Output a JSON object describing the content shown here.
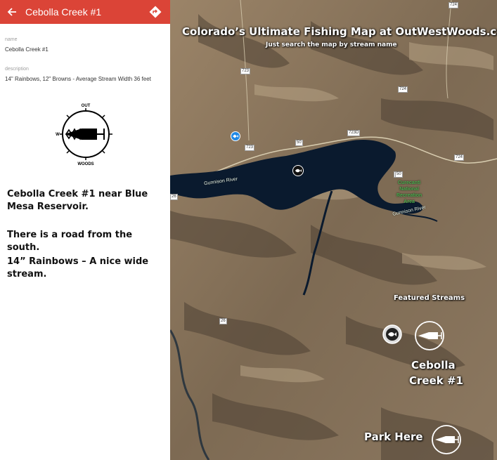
{
  "sidebar": {
    "title": "Cebolla Creek #1",
    "back_icon": "arrow-back-icon",
    "directions_icon": "directions-icon",
    "fields": [
      {
        "label": "name",
        "value": "Cebolla Creek #1"
      },
      {
        "label": "description",
        "value": "14\" Rainbows, 12\" Browns - Average Stream Width 36 feet"
      }
    ],
    "compass": {
      "top": "OUT",
      "left": "W",
      "bottom": "WOODS"
    },
    "blurb": [
      "Cebolla Creek #1 near Blue Mesa Reservoir.",
      "There is a road from the south.",
      "14” Rainbows – A nice wide stream."
    ]
  },
  "map": {
    "headline": "Colorado’s Ultimate Fishing Map at OutWestWoods.com",
    "subline": "Just search the map by stream name",
    "featured_label": "Featured Streams",
    "stream_label_1": "Cebolla",
    "stream_label_2": "Creek #1",
    "park_label": "Park Here",
    "river_label_1": "Gunnison River",
    "river_label_2": "Gunnison River",
    "rec_area": [
      "Curecanti",
      "National",
      "Recreation",
      "Area"
    ],
    "roads": [
      "724",
      "723",
      "723",
      "724",
      "723D",
      "50",
      "50",
      "724",
      "26",
      "26",
      "50"
    ],
    "colors": {
      "header": "#db4437",
      "water": "#0a1a2e",
      "terrain": "#8a7358"
    }
  }
}
